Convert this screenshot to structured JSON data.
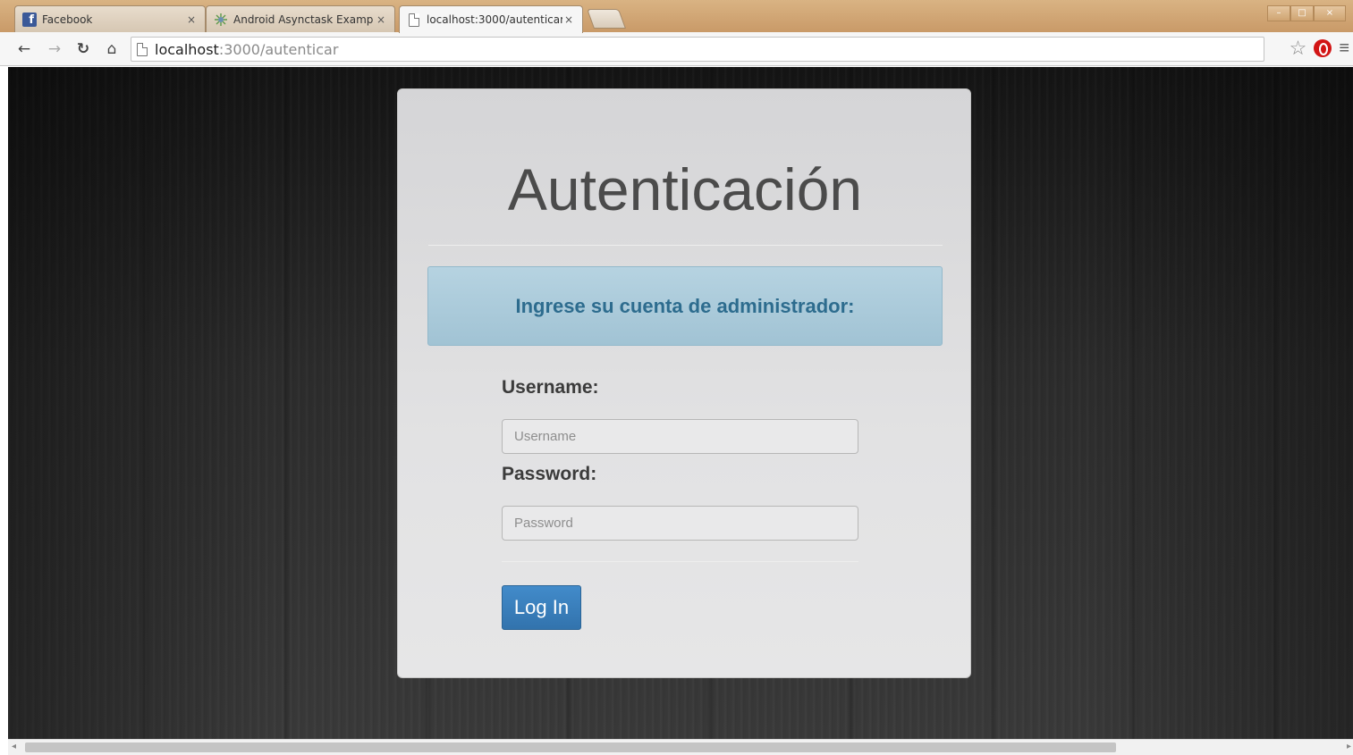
{
  "browser": {
    "tabs": [
      {
        "title": "Facebook",
        "icon": "facebook-icon",
        "active": false
      },
      {
        "title": "Android Asynctask Examp",
        "icon": "android-studio-icon",
        "active": false
      },
      {
        "title": "localhost:3000/autenticar",
        "icon": "page-icon",
        "active": true
      }
    ],
    "tab_close_glyph": "×",
    "url_host": "localhost",
    "url_rest": ":3000/autenticar",
    "accent_colors": {
      "tabstrip": "#c99a68",
      "opera": "#d21414"
    }
  },
  "page": {
    "title": "Autenticación",
    "alert": "Ingrese su cuenta de administrador:",
    "username_label": "Username:",
    "username_placeholder": "Username",
    "username_value": "",
    "password_label": "Password:",
    "password_placeholder": "Password",
    "password_value": "",
    "login_button": "Log In",
    "colors": {
      "alert_bg": "#a1c3d4",
      "alert_text": "#2d6c8e",
      "button": "#428bca"
    }
  }
}
